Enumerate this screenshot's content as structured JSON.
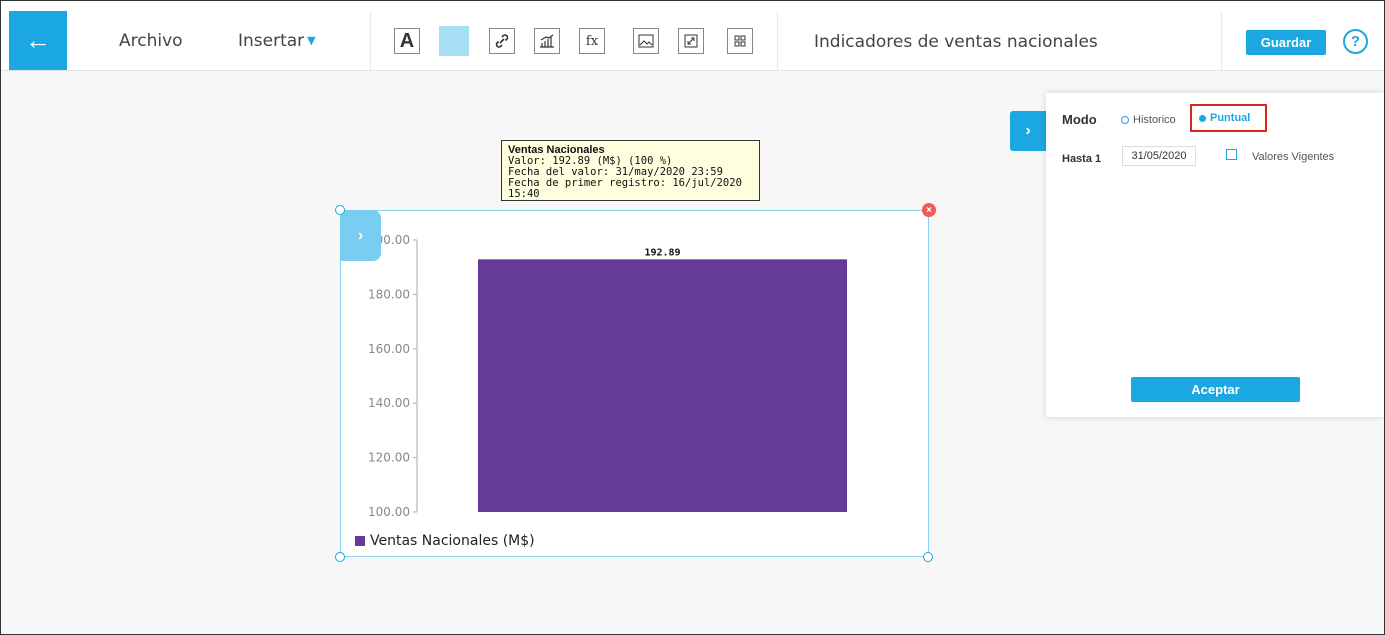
{
  "header": {
    "back_icon": "arrow-left-icon",
    "menu": {
      "archivo": "Archivo",
      "insertar": "Insertar"
    },
    "toolbar_text_tool": "A",
    "toolbar_formula_tool": "fx",
    "doc_title": "Indicadores de ventas nacionales",
    "save_label": "Guardar",
    "help_label": "?"
  },
  "tooltip": {
    "title": "Ventas Nacionales",
    "line1": "Valor: 192.89 (M$) (100 %)",
    "line2": "Fecha del valor: 31/may/2020 23:59",
    "line3": "Fecha de primer registro: 16/jul/2020 15:40"
  },
  "panel": {
    "modo_label": "Modo",
    "historico_label": "Historico",
    "puntual_label": "Puntual",
    "hasta_label": "Hasta 1",
    "hasta_value": "31/05/2020",
    "vigentes_label": "Valores Vigentes",
    "accept_label": "Aceptar"
  },
  "chart_data": {
    "type": "bar",
    "categories": [
      "Ventas Nacionales (M$)"
    ],
    "series": [
      {
        "name": "Ventas Nacionales (M$)",
        "values": [
          192.89
        ]
      }
    ],
    "data_labels": [
      "192.89"
    ],
    "yticks": [
      "100.00",
      "120.00",
      "140.00",
      "160.00",
      "180.00",
      "200.00"
    ],
    "ylim": [
      100,
      200
    ],
    "bar_color": "#663a99",
    "legend": "Ventas Nacionales (M$)",
    "legend_position": "bottom-left",
    "grid": false
  },
  "colors": {
    "accent": "#1ba7e1",
    "highlight": "#e02424"
  }
}
